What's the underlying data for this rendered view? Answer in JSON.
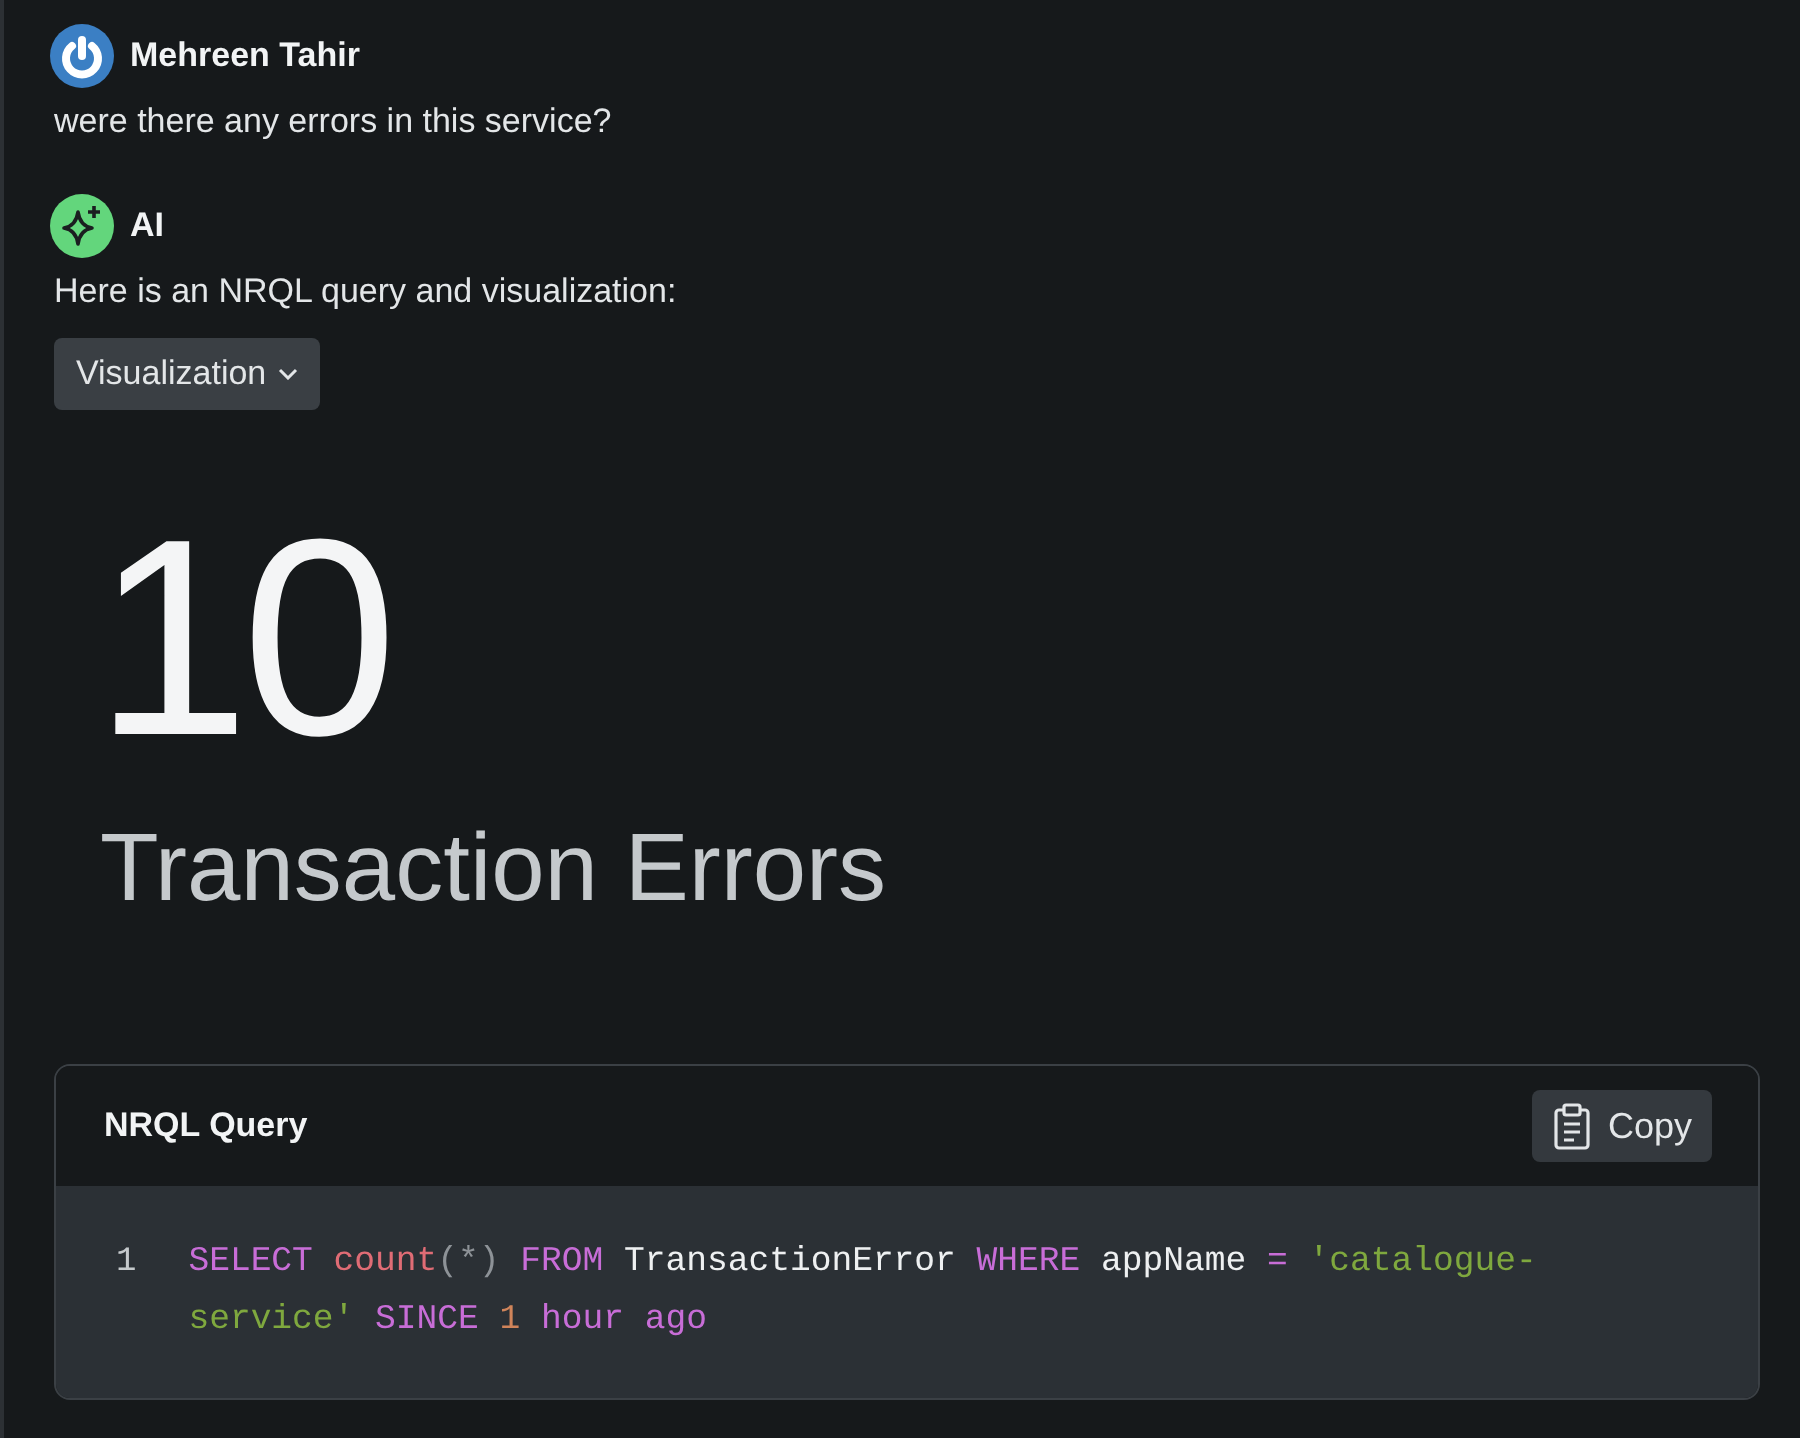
{
  "messages": [
    {
      "kind": "user",
      "author": "Mehreen Tahir",
      "text": "were there any errors in this service?"
    },
    {
      "kind": "ai",
      "author": "AI",
      "text": "Here is an NRQL query and visualization:"
    }
  ],
  "dropdown": {
    "label": "Visualization"
  },
  "billboard": {
    "value": "10",
    "label": "Transaction Errors"
  },
  "query_panel": {
    "title": "NRQL Query",
    "copy_button": "Copy",
    "line_number": "1",
    "tokens": [
      {
        "kind": "keyword",
        "text": "SELECT "
      },
      {
        "kind": "function",
        "text": "count"
      },
      {
        "kind": "punct",
        "text": "(*) "
      },
      {
        "kind": "keyword",
        "text": "FROM"
      },
      {
        "kind": "plain",
        "text": " TransactionError "
      },
      {
        "kind": "keyword",
        "text": "WHERE"
      },
      {
        "kind": "plain",
        "text": " appName "
      },
      {
        "kind": "keyword",
        "text": "= "
      },
      {
        "kind": "string",
        "text": "'catalogue-service' "
      },
      {
        "kind": "keyword",
        "text": "SINCE "
      },
      {
        "kind": "number",
        "text": "1 "
      },
      {
        "kind": "keyword",
        "text": "hour ago"
      }
    ]
  }
}
